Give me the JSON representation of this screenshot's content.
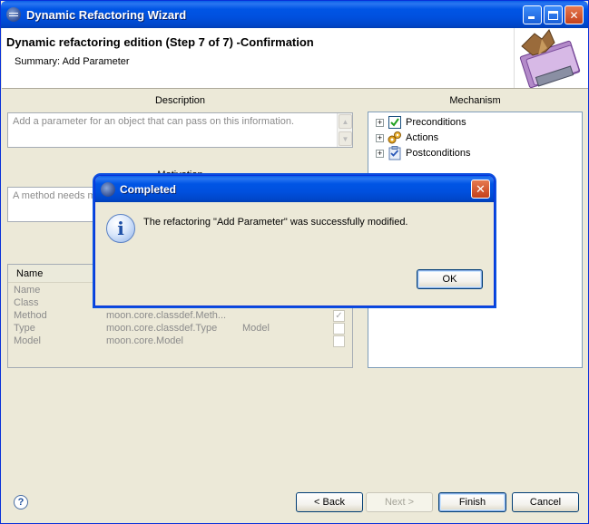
{
  "window": {
    "title": "Dynamic Refactoring Wizard"
  },
  "header": {
    "step_title": "Dynamic refactoring edition (Step 7 of 7) -Confirmation",
    "summary": "Summary: Add Parameter"
  },
  "description": {
    "label": "Description",
    "text": "Add a parameter for an object that can pass on this information."
  },
  "motivation": {
    "label": "Motivation",
    "text": "A method needs mo"
  },
  "inputs_table": {
    "header": "Name",
    "rows": [
      {
        "name": "Name",
        "type": "",
        "extra": "",
        "checked": ""
      },
      {
        "name": "Class",
        "type": "",
        "extra": "",
        "checked": ""
      },
      {
        "name": "Method",
        "type": "moon.core.classdef.Meth...",
        "extra": "",
        "checked": "✓"
      },
      {
        "name": "Type",
        "type": "moon.core.classdef.Type",
        "extra": "Model",
        "checked": ""
      },
      {
        "name": "Model",
        "type": "moon.core.Model",
        "extra": "",
        "checked": ""
      }
    ]
  },
  "mechanism": {
    "label": "Mechanism",
    "items": [
      {
        "label": "Preconditions",
        "icon": "checkbox-checked-icon"
      },
      {
        "label": "Actions",
        "icon": "gears-icon"
      },
      {
        "label": "Postconditions",
        "icon": "clipboard-check-icon"
      }
    ]
  },
  "buttons": {
    "back": "< Back",
    "next": "Next >",
    "finish": "Finish",
    "cancel": "Cancel"
  },
  "dialog": {
    "title": "Completed",
    "message": "The refactoring \"Add Parameter\" was successfully modified.",
    "ok": "OK"
  }
}
